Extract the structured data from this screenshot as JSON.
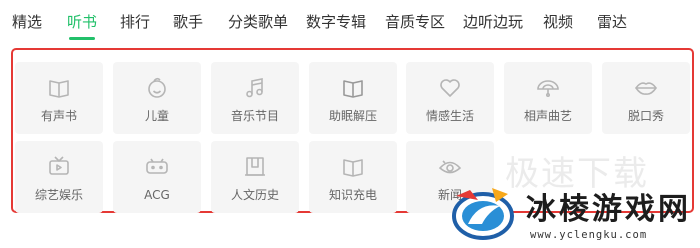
{
  "nav": {
    "items": [
      {
        "label": "精选"
      },
      {
        "label": "听书",
        "active": true
      },
      {
        "label": "排行"
      },
      {
        "label": "歌手"
      },
      {
        "label": "分类歌单"
      },
      {
        "label": "数字专辑"
      },
      {
        "label": "音质专区"
      },
      {
        "label": "边听边玩"
      },
      {
        "label": "视频"
      },
      {
        "label": "雷达"
      }
    ]
  },
  "categories": {
    "row1": [
      {
        "label": "有声书",
        "icon": "book-icon"
      },
      {
        "label": "儿童",
        "icon": "child-face-icon"
      },
      {
        "label": "音乐节目",
        "icon": "music-note-icon"
      },
      {
        "label": "助眠解压",
        "icon": "book-icon"
      },
      {
        "label": "情感生活",
        "icon": "heart-icon"
      },
      {
        "label": "相声曲艺",
        "icon": "fan-icon"
      },
      {
        "label": "脱口秀",
        "icon": "lips-icon"
      }
    ],
    "row2": [
      {
        "label": "综艺娱乐",
        "icon": "tv-icon"
      },
      {
        "label": "ACG",
        "icon": "gamepad-icon"
      },
      {
        "label": "人文历史",
        "icon": "building-icon"
      },
      {
        "label": "知识充电",
        "icon": "book-icon"
      },
      {
        "label": "新闻",
        "icon": "eye-icon"
      }
    ]
  },
  "watermark": {
    "background_text": "极速下载",
    "brand_name": "冰棱游戏网",
    "brand_url": "www.yclengku.com"
  },
  "colors": {
    "accent": "#22c06a",
    "frame": "#e53935",
    "tile_bg": "#f5f5f5",
    "icon": "#b5b5b5"
  }
}
